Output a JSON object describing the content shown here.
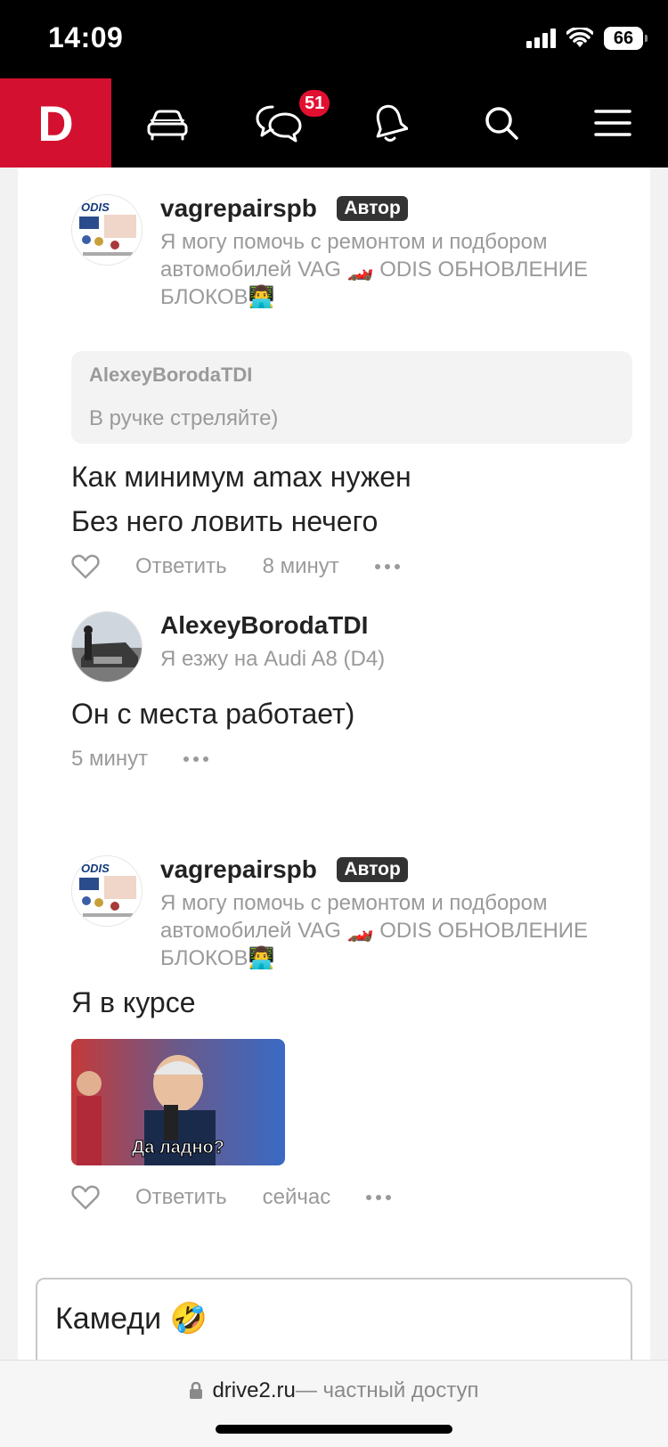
{
  "status": {
    "time": "14:09",
    "battery": "66"
  },
  "nav": {
    "logo": "D",
    "messages_badge": "51"
  },
  "comments": [
    {
      "user": "vagrepairspb",
      "badge": "Автор",
      "bio": "Я могу помочь с ремонтом и подбором автомобилей VAG 🏎️ ODIS ОБНОВЛЕНИЕ БЛОКОВ👨‍💻",
      "quote_user": "AlexeyBorodaTDI",
      "quote_text": "В ручке стреляйте)",
      "text_line1": "Как минимум amax нужен",
      "text_line2": "Без него ловить нечего",
      "reply": "Ответить",
      "time": "8 минут"
    },
    {
      "user": "AlexeyBorodaTDI",
      "bio": "Я езжу на Audi A8 (D4)",
      "text": "Он с места работает)",
      "time": "5 минут"
    },
    {
      "user": "vagrepairspb",
      "badge": "Автор",
      "bio": "Я могу помочь с ремонтом и подбором автомобилей VAG 🏎️ ODIS ОБНОВЛЕНИЕ БЛОКОВ👨‍💻",
      "text": "Я в курсе",
      "meme_caption": "Да ладно?",
      "reply": "Ответить",
      "time": "сейчас"
    }
  ],
  "input": {
    "value": "Камеди 🤣"
  },
  "browser": {
    "domain": "drive2.ru",
    "suffix": " — частный доступ"
  },
  "avatar_logo": "ODIS"
}
